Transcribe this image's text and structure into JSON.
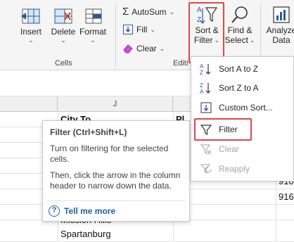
{
  "ribbon": {
    "cells_group": {
      "label": "Cells",
      "insert": "Insert",
      "delete": "Delete",
      "format": "Format",
      "chevron": "⌄"
    },
    "editing_group": {
      "label": "Editi",
      "autosum": "AutoSum",
      "fill": "Fill",
      "clear": "Clear",
      "sort_filter_line1": "Sort &",
      "sort_filter_line2": "Filter",
      "find_select_line1": "Find &",
      "find_select_line2": "Select",
      "chevron": "⌄"
    },
    "analyze_line1": "Analyze",
    "analyze_line2": "Data",
    "analysis_label": "sis"
  },
  "sheet": {
    "column_j": "J",
    "row1_j": "City To",
    "row1_k": "Pl",
    "row4_l": "910",
    "row5_l": "916",
    "row7_j": "Mission Hills",
    "row8_j": "Spartanburg"
  },
  "tooltip": {
    "title": "Filter (Ctrl+Shift+L)",
    "para1": "Turn on filtering for the selected cells.",
    "para2": "Then, click the arrow in the column header to narrow down the data.",
    "link": "Tell me more"
  },
  "menu": {
    "items": [
      {
        "label": "Sort A to Z",
        "enabled": true
      },
      {
        "label": "Sort Z to A",
        "enabled": true
      },
      {
        "label": "Custom Sort...",
        "enabled": true
      },
      {
        "label": "Filter",
        "enabled": true,
        "highlighted": true
      },
      {
        "label": "Clear",
        "enabled": false
      },
      {
        "label": "Reapply",
        "enabled": false
      }
    ]
  },
  "colors": {
    "highlight": "#e0474c",
    "link": "#1e5fa8",
    "accent_blue": "#2b579a"
  }
}
